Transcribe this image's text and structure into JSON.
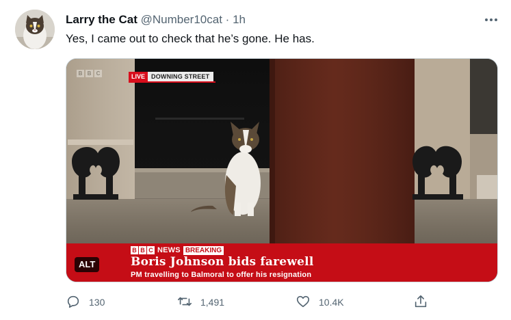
{
  "tweet": {
    "author_name": "Larry the Cat",
    "handle": "@Number10cat",
    "separator": "·",
    "time": "1h",
    "text": "Yes, I came out to check that he’s gone. He has.",
    "more_icon": "more-horizontal-icon"
  },
  "media": {
    "alt_badge": "ALT",
    "broadcast": {
      "watermark_logo": [
        "B",
        "B",
        "C"
      ],
      "live_label": "LIVE",
      "location": "DOWNING STREET",
      "news_logo": [
        "B",
        "B",
        "C"
      ],
      "news_label": "NEWS",
      "breaking_label": "BREAKING",
      "headline": "Boris Johnson bids farewell",
      "subline": "PM travelling to Balmoral to offer his resignation",
      "strap_color": "#c50d16"
    }
  },
  "actions": {
    "reply": {
      "icon": "reply-icon",
      "count": "130"
    },
    "retweet": {
      "icon": "retweet-icon",
      "count": "1,491"
    },
    "like": {
      "icon": "heart-icon",
      "count": "10.4K"
    },
    "share": {
      "icon": "share-icon"
    }
  },
  "colors": {
    "text_primary": "#0f1419",
    "text_secondary": "#536471",
    "bbc_red": "#c50d16",
    "live_red": "#d80e1c"
  }
}
